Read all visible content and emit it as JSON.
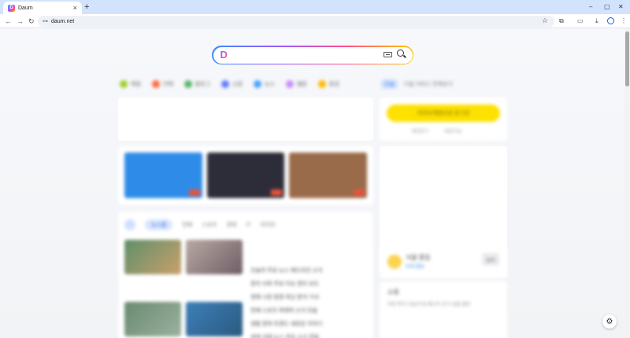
{
  "browser": {
    "tab_title": "Daum",
    "tab_close": "×",
    "new_tab": "+",
    "win_min": "–",
    "win_max": "▢",
    "win_close": "✕",
    "back": "←",
    "forward": "→",
    "reload": "↻",
    "site_info": "⊶",
    "url": "daum.net",
    "star": "☆",
    "extensions": "⧉",
    "cast": "▭",
    "download": "⤓",
    "menu": "⋮"
  },
  "search": {
    "logo": "D"
  },
  "shortcuts": [
    {
      "label": "메일",
      "color": "#9bcf2b"
    },
    {
      "label": "카페",
      "color": "#ff6a3d"
    },
    {
      "label": "블로그",
      "color": "#58b36a"
    },
    {
      "label": "쇼핑",
      "color": "#5b7cff"
    },
    {
      "label": "뉴스",
      "color": "#4aa1ff"
    },
    {
      "label": "웹툰",
      "color": "#c78bff"
    },
    {
      "label": "증권",
      "color": "#ffb800"
    }
  ],
  "right_top": {
    "pill": "오늘",
    "text": "다음 서비스 전체보기"
  },
  "media": [
    {
      "color": "#2e8ce8"
    },
    {
      "color": "#2d2d3a"
    },
    {
      "color": "#9a6b4a"
    }
  ],
  "news": {
    "active_tab": "뉴스홈",
    "tabs": [
      "연예",
      "스포츠",
      "경제",
      "IT",
      "라이프"
    ],
    "lines": [
      "오늘의 주요 뉴스 헤드라인 소식",
      "정치 사회 주요 이슈 정리 보도",
      "경제 시장 동향 최신 분석 기사",
      "연예 스포츠 화제의 소식 모음",
      "생활 문화 트렌드 새로운 이야기",
      "세계 국제 뉴스 주요 소식 전달"
    ]
  },
  "login": {
    "button": "카카오계정으로 로그인",
    "links": [
      "계정찾기",
      "회원가입"
    ]
  },
  "weather": {
    "title": "서울 맑음",
    "sub": "미세 좋음",
    "badge": "날씨"
  },
  "shop": {
    "title": "쇼핑",
    "tags": "추천 특가 오늘의 딜 베스트 인기 상품 할인"
  },
  "settings_icon": "⚙"
}
